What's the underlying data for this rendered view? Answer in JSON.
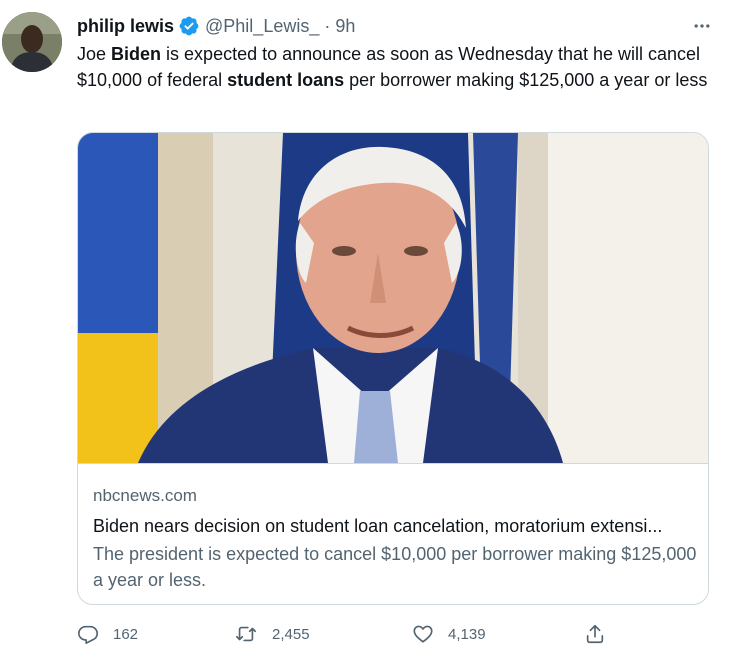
{
  "author": {
    "name": "philip lewis",
    "handle": "@Phil_Lewis_",
    "separator": "·",
    "time": "9h"
  },
  "tweet": {
    "t1": "Joe ",
    "t2": "Biden",
    "t3": " is expected to announce as soon as Wednesday that he will cancel $10,000 of federal ",
    "t4": "student loans",
    "t5": " per borrower making $125,000 a year or less"
  },
  "card": {
    "domain": "nbcnews.com",
    "headline": "Biden nears decision on student loan cancelation, moratorium extensi...",
    "description": "The president is expected to cancel $10,000 per borrower making $125,000 a year or less."
  },
  "actions": {
    "replies": "162",
    "retweets": "2,455",
    "likes": "4,139"
  },
  "icons": {
    "verified": "verified-badge-icon",
    "more": "more-horizontal-icon",
    "reply": "reply-icon",
    "retweet": "retweet-icon",
    "like": "heart-icon",
    "share": "share-icon"
  },
  "colors": {
    "verified_blue": "#1d9bf0",
    "secondary_text": "#536471",
    "primary_text": "#0f1419",
    "border": "#cfd9de"
  }
}
